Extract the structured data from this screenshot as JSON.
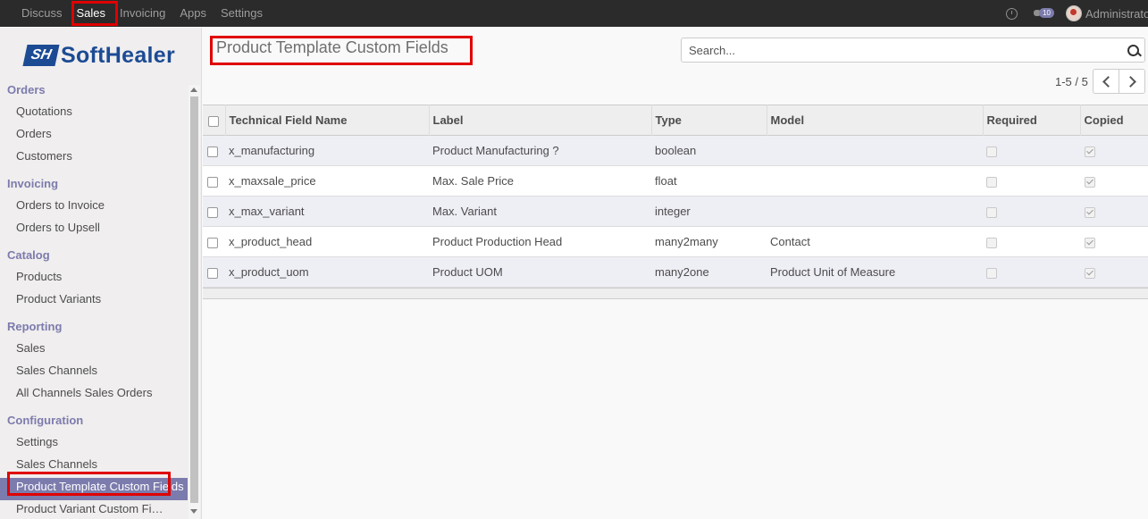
{
  "topbar": {
    "menu": [
      "Discuss",
      "Sales",
      "Invoicing",
      "Apps",
      "Settings"
    ],
    "active": "Sales",
    "message_count": "10",
    "user": "Administrator"
  },
  "logo": {
    "mark": "SH",
    "word": "SoftHealer"
  },
  "sidebar": {
    "orders": {
      "title": "Orders",
      "items": [
        "Quotations",
        "Orders",
        "Customers"
      ]
    },
    "invoicing": {
      "title": "Invoicing",
      "items": [
        "Orders to Invoice",
        "Orders to Upsell"
      ]
    },
    "catalog": {
      "title": "Catalog",
      "items": [
        "Products",
        "Product Variants"
      ]
    },
    "reporting": {
      "title": "Reporting",
      "items": [
        "Sales",
        "Sales Channels",
        "All Channels Sales Orders"
      ]
    },
    "configuration": {
      "title": "Configuration",
      "items": [
        "Settings",
        "Sales Channels",
        "Product Template Custom Fields",
        "Product Variant Custom Fields"
      ]
    }
  },
  "page": {
    "title": "Product Template Custom Fields",
    "search_placeholder": "Search...",
    "pager": "1-5 / 5"
  },
  "table": {
    "columns": [
      "Technical Field Name",
      "Label",
      "Type",
      "Model",
      "Required",
      "Copied"
    ],
    "rows": [
      {
        "name": "x_manufacturing",
        "label": "Product Manufacturing ?",
        "type": "boolean",
        "model": "",
        "required": false,
        "copied": true
      },
      {
        "name": "x_maxsale_price",
        "label": "Max. Sale Price",
        "type": "float",
        "model": "",
        "required": false,
        "copied": true
      },
      {
        "name": "x_max_variant",
        "label": "Max. Variant",
        "type": "integer",
        "model": "",
        "required": false,
        "copied": true
      },
      {
        "name": "x_product_head",
        "label": "Product Production Head",
        "type": "many2many",
        "model": "Contact",
        "required": false,
        "copied": true
      },
      {
        "name": "x_product_uom",
        "label": "Product UOM",
        "type": "many2one",
        "model": "Product Unit of Measure",
        "required": false,
        "copied": true
      }
    ]
  },
  "colors": {
    "accent": "#7c7bad",
    "highlight": "#e00000",
    "topbar": "#2b2b2b"
  }
}
